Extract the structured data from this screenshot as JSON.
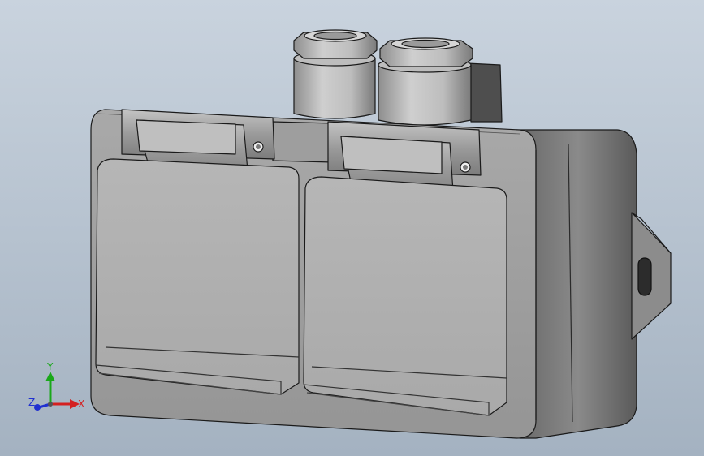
{
  "scene": {
    "background_top": "#c9d3de",
    "background_bottom": "#a4b2c1",
    "model_body_color": "#8d8d8d",
    "model_face_color": "#b4b4b4",
    "model_dark_color": "#4a4a4a",
    "edge_color": "#1a1a1a"
  },
  "triad": {
    "x_label": "X",
    "y_label": "Y",
    "z_label": "Z",
    "x_color": "#d42020",
    "y_color": "#1aa81a",
    "z_color": "#2030d0"
  }
}
